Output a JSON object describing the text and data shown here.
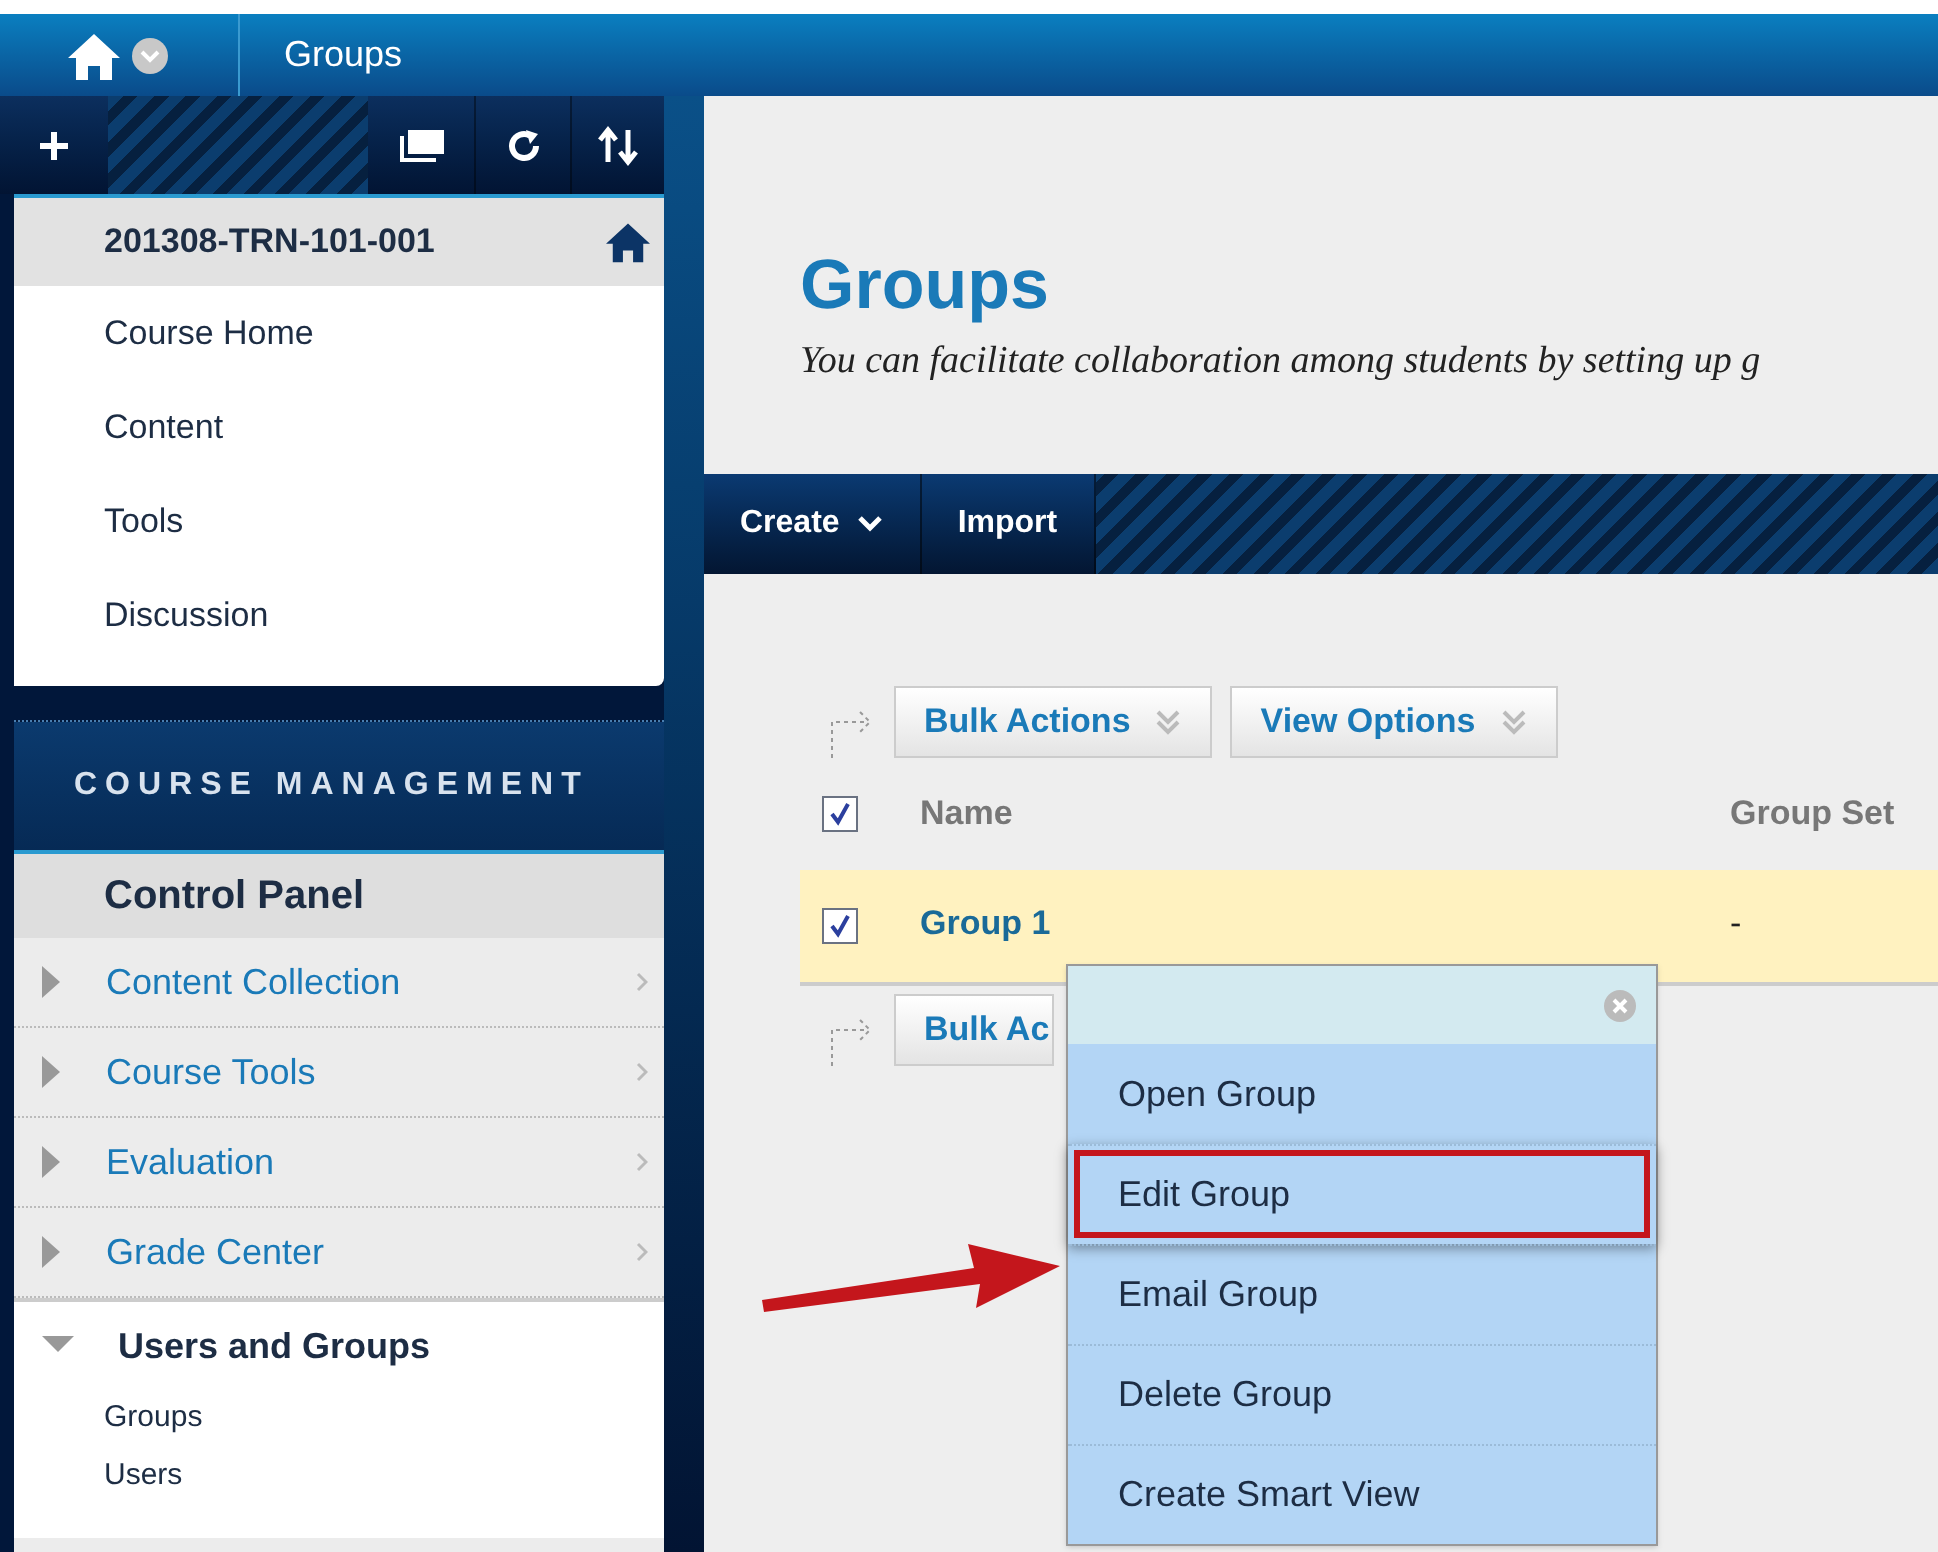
{
  "top_bar": {
    "title": "Groups"
  },
  "course": {
    "title": "201308-TRN-101-001",
    "links": [
      {
        "label": "Course Home"
      },
      {
        "label": "Content"
      },
      {
        "label": "Tools"
      },
      {
        "label": "Discussion"
      }
    ]
  },
  "course_management": {
    "heading": "COURSE MANAGEMENT",
    "panel_title": "Control Panel",
    "items": [
      {
        "label": "Content Collection",
        "expanded": false
      },
      {
        "label": "Course Tools",
        "expanded": false
      },
      {
        "label": "Evaluation",
        "expanded": false
      },
      {
        "label": "Grade Center",
        "expanded": false
      },
      {
        "label": "Users and Groups",
        "expanded": true,
        "children": [
          {
            "label": "Groups"
          },
          {
            "label": "Users"
          }
        ]
      }
    ]
  },
  "page": {
    "title": "Groups",
    "description": "You can facilitate collaboration among students by setting up g"
  },
  "action_bar": [
    {
      "label": "Create",
      "dropdown": true
    },
    {
      "label": "Import",
      "dropdown": false
    }
  ],
  "toolbar_buttons": [
    {
      "label": "Bulk Actions"
    },
    {
      "label": "View Options"
    }
  ],
  "table": {
    "columns": [
      "Name",
      "Group Set"
    ],
    "header_checked": true,
    "rows": [
      {
        "cells": [
          "Group 1",
          "-"
        ],
        "checked": true
      }
    ]
  },
  "bottom_button": {
    "label": "Bulk Ac"
  },
  "context_menu": {
    "items": [
      {
        "label": "Open Group",
        "highlighted": false
      },
      {
        "label": "Edit Group",
        "highlighted": true
      },
      {
        "label": "Email Group",
        "highlighted": false
      },
      {
        "label": "Delete Group",
        "highlighted": false
      },
      {
        "label": "Create Smart View",
        "highlighted": false
      }
    ]
  }
}
